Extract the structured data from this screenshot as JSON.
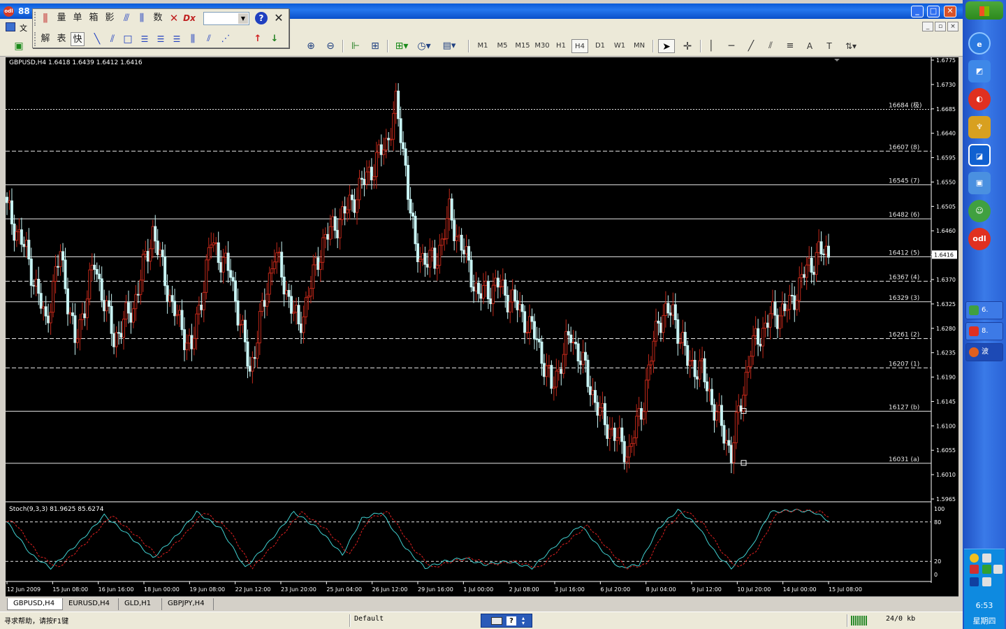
{
  "window": {
    "title": "88"
  },
  "menubar": {
    "items": [
      "文"
    ]
  },
  "toolbar": {
    "timeframes": [
      "M1",
      "M5",
      "M15",
      "M30",
      "H1",
      "H4",
      "D1",
      "W1",
      "MN"
    ],
    "selected_timeframe": "H4"
  },
  "floating_toolbar": {
    "row1": [
      "量",
      "单",
      "箱",
      "影",
      "数"
    ],
    "row2": [
      "解",
      "表",
      "快"
    ],
    "combo_value": ""
  },
  "chart": {
    "info": "GBPUSD,H4  1.6418 1.6439 1.6412 1.6416",
    "stoch_info": "Stoch(9,3,3) 81.9625 85.6274",
    "current_price_label": "1.6416"
  },
  "chart_data": {
    "type": "candlestick",
    "symbol": "GBPUSD",
    "timeframe": "H4",
    "ohlc_last": [
      1.6418,
      1.6439,
      1.6412,
      1.6416
    ],
    "price_axis_ticks": [
      "1.6775",
      "1.6730",
      "1.6685",
      "1.6640",
      "1.6595",
      "1.6550",
      "1.6505",
      "1.6460",
      "1.6416",
      "1.6370",
      "1.6325",
      "1.6280",
      "1.6235",
      "1.6190",
      "1.6145",
      "1.6100",
      "1.6055",
      "1.6010",
      "1.5965"
    ],
    "ylim": [
      1.5965,
      1.6775
    ],
    "time_axis_labels": [
      "12 Jun 2009",
      "15 Jun 08:00",
      "16 Jun 16:00",
      "18 Jun 00:00",
      "19 Jun 08:00",
      "22 Jun 12:00",
      "23 Jun 20:00",
      "25 Jun 04:00",
      "26 Jun 12:00",
      "29 Jun 16:00",
      "1 Jul 00:00",
      "2 Jul 08:00",
      "3 Jul 16:00",
      "6 Jul 20:00",
      "8 Jul 04:00",
      "9 Jul 12:00",
      "10 Jul 20:00",
      "14 Jul 00:00",
      "15 Jul 08:00"
    ],
    "fib_levels": [
      {
        "label": "16684 (极)",
        "value": 1.6684,
        "style": "dotted"
      },
      {
        "label": "16607 (8)",
        "value": 1.6607,
        "style": "dashed"
      },
      {
        "label": "16545 (7)",
        "value": 1.6545,
        "style": "solid"
      },
      {
        "label": "16482 (6)",
        "value": 1.6482,
        "style": "solid"
      },
      {
        "label": "16412 (5)",
        "value": 1.6412,
        "style": "solid"
      },
      {
        "label": "16367 (4)",
        "value": 1.6367,
        "style": "dashed"
      },
      {
        "label": "16329 (3)",
        "value": 1.6329,
        "style": "solid"
      },
      {
        "label": "16261 (2)",
        "value": 1.6261,
        "style": "dashed"
      },
      {
        "label": "16207 (1)",
        "value": 1.6207,
        "style": "dashed"
      },
      {
        "label": "16127 (b)",
        "value": 1.6127,
        "style": "solid"
      },
      {
        "label": "16031 (a)",
        "value": 1.6031,
        "style": "solid"
      }
    ],
    "stoch_axis_ticks": [
      "100",
      "80",
      "20",
      "0"
    ],
    "stoch_levels": [
      80,
      20
    ],
    "stoch_values": {
      "main": 81.9625,
      "signal": 85.6274
    },
    "colors": {
      "bull": "#c0281a",
      "bear": "#c8f4f4",
      "stoch_main": "#40d0d0",
      "stoch_signal": "#e02020",
      "background": "#000000"
    }
  },
  "tabs": [
    "GBPUSD,H4",
    "EURUSD,H4",
    "GLD,H1",
    "GBPJPY,H4"
  ],
  "active_tab": "GBPUSD,H4",
  "statusbar": {
    "help": "寻求帮助，请按F1键",
    "profile": "Default",
    "traffic": "24/0 kb"
  },
  "taskbar": {
    "tasks": [
      "6.",
      "8.",
      "波"
    ],
    "clock": "6:53",
    "day": "星期四",
    "quicklaunch": [
      "ie-icon",
      "browser-icon",
      "odl-icon",
      "tool-icon",
      "app-icon",
      "window-icon",
      "msn-icon",
      "odl2-icon"
    ]
  }
}
